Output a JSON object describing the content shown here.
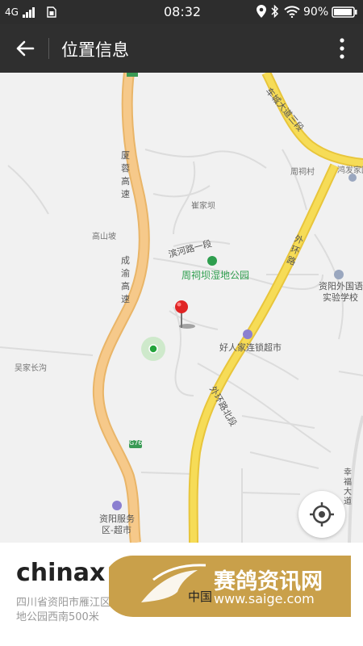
{
  "status_bar": {
    "network": "4G",
    "time": "08:32",
    "battery": "90%",
    "icons": [
      "signal-icon",
      "sim-icon",
      "location-icon",
      "bluetooth-icon",
      "wifi-icon",
      "battery-icon"
    ]
  },
  "appbar": {
    "title": "位置信息",
    "back_icon": "arrow-left-icon",
    "more_icon": "more-vertical-icon"
  },
  "map": {
    "roads": {
      "highway_name": "厦蓉高速",
      "highway_name2": "成渝高速",
      "ring_road": "外环路",
      "ring_road_segment": "外环路北段",
      "avenue": "车城大道三段",
      "binhe": "滨河路一段",
      "xingfu": "幸福大道",
      "highway_code": "G76"
    },
    "places": {
      "zhoucicun": "周祠村",
      "cuijiaba": "崔家坝",
      "gaoshanpo": "高山坡",
      "hongfajia": "鸿发家园",
      "wujiachanggou": "吴家长沟"
    },
    "pois": {
      "park": "周祠坝湿地公园",
      "school_line1": "资阳外国语",
      "school_line2": "实验学校",
      "supermarket": "好人家连锁超市",
      "service_line1": "资阳服务",
      "service_line2": "区-超市"
    },
    "colors": {
      "road_yellow": "#f5d44a",
      "road_orange": "#f5c27a",
      "map_bg": "#f1f1f1",
      "pin_red": "#e02424",
      "location_green": "#22a33a"
    }
  },
  "panel": {
    "place_name": "chinax",
    "address": "四川省资阳市雁江区周祠坝湿地公园西南500米"
  },
  "watermark": {
    "title": "赛鸽资讯网",
    "url": "www.saige.com",
    "overlay_text": "中国"
  }
}
